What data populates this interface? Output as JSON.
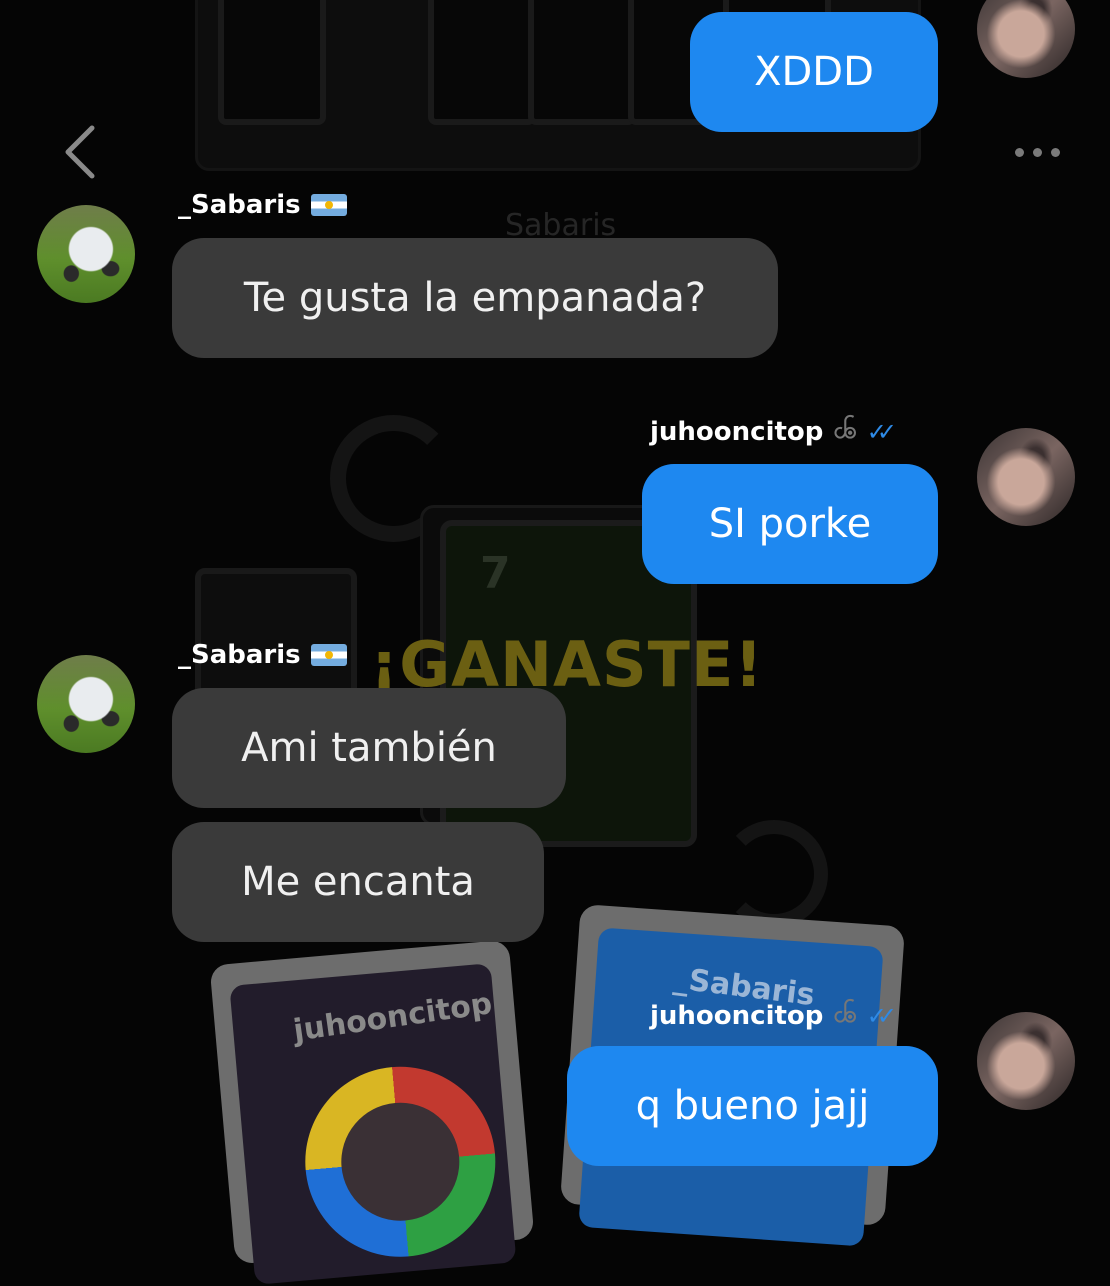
{
  "background": {
    "game_name_label": "Sabaris",
    "card_number": "7",
    "result_banner": "¡GANASTE!",
    "player_card_1_name": "juhooncitop",
    "player_card_2_name": "_Sabaris"
  },
  "header": {
    "back_icon": "chevron-left-icon",
    "more_icon": "more-dots-icon"
  },
  "users": {
    "other": {
      "name": "_Sabaris",
      "flag": "argentina-flag-icon",
      "avatar": "car-photo"
    },
    "me": {
      "name": "juhooncitop",
      "badge": "ꧾ",
      "read_receipt": "✓✓",
      "avatar": "tattooed-arm-photo"
    }
  },
  "messages": [
    {
      "from": "me",
      "text": "XDDD"
    },
    {
      "from": "other",
      "text": "Te gusta la empanada?"
    },
    {
      "from": "me",
      "text": "SI porke"
    },
    {
      "from": "other",
      "text": "Ami también"
    },
    {
      "from": "other",
      "text": "Me encanta"
    },
    {
      "from": "me",
      "text": "q bueno jajj"
    }
  ],
  "colors": {
    "outgoing_bubble": "#1e88f0",
    "incoming_bubble": "#3a3a3a",
    "background": "#050505",
    "read_receipt": "#2e8ae6"
  }
}
